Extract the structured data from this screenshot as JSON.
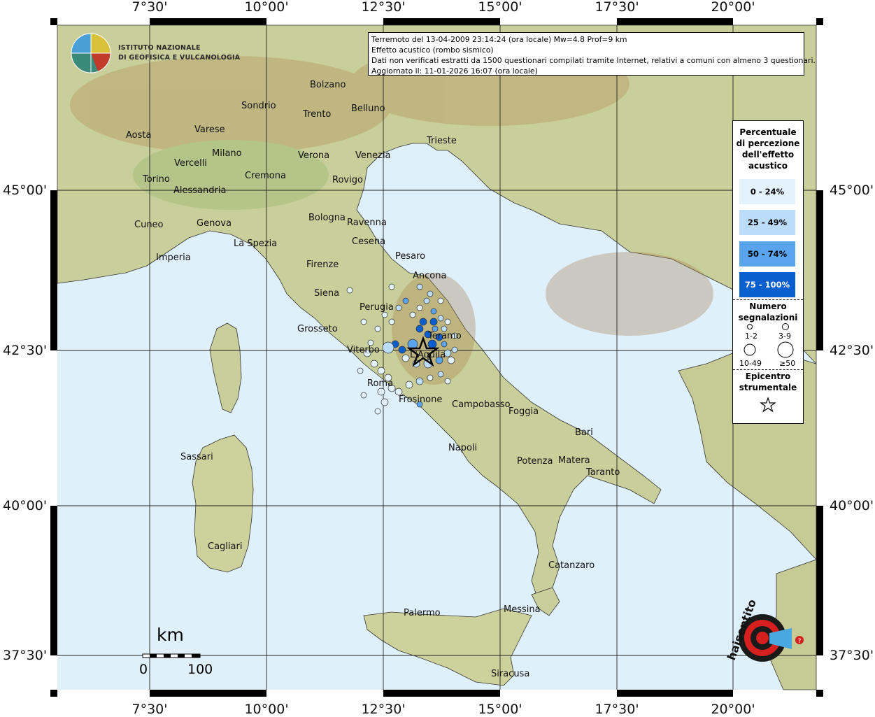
{
  "info_box": {
    "line1": "Terremoto del 13-04-2009 23:14:24 (ora locale) Mw=4.8 Prof=9 km",
    "line2": "Effetto acustico (rombo sismico)",
    "line3": "Dati non verificati estratti da 1500 questionari compilati tramite Internet, relativi a comuni con almeno 3 questionari.",
    "line4": "Aggiornato il: 11-01-2026 16:07 (ora locale)"
  },
  "institute": {
    "line1": "ISTITUTO NAZIONALE",
    "line2": "DI GEOFISICA E VULCANOLOGIA"
  },
  "legend": {
    "title_lines": [
      "Percentuale",
      "di percezione",
      "dell'effetto",
      "acustico"
    ],
    "classes": [
      {
        "label": "0 - 24%",
        "color": "#e3f2fd"
      },
      {
        "label": "25 - 49%",
        "color": "#bcdcfb"
      },
      {
        "label": "50 - 74%",
        "color": "#5aa4ee"
      },
      {
        "label": "75 - 100%",
        "color": "#0a5fcf"
      }
    ],
    "count_title_lines": [
      "Numero",
      "segnalazioni"
    ],
    "count_classes": [
      "1-2",
      "3-9",
      "10-49",
      "≥50"
    ],
    "epicenter_lines": [
      "Epicentro",
      "strumentale"
    ]
  },
  "axes": {
    "lon_labels": [
      "7°30'",
      "10°00'",
      "12°30'",
      "15°00'",
      "17°30'",
      "20°00'"
    ],
    "lat_labels": [
      "45°00'",
      "42°30'",
      "40°00'",
      "37°30'"
    ]
  },
  "scale_bar": {
    "unit": "km",
    "start": "0",
    "end": "100"
  },
  "cities": [
    {
      "name": "Aosta"
    },
    {
      "name": "Varese"
    },
    {
      "name": "Sondrio"
    },
    {
      "name": "Bolzano"
    },
    {
      "name": "Belluno"
    },
    {
      "name": "Trento"
    },
    {
      "name": "Milano"
    },
    {
      "name": "Vercelli"
    },
    {
      "name": "Verona"
    },
    {
      "name": "Venezia"
    },
    {
      "name": "Trieste"
    },
    {
      "name": "Cremona"
    },
    {
      "name": "Rovigo"
    },
    {
      "name": "Torino"
    },
    {
      "name": "Alessandria"
    },
    {
      "name": "Bologna"
    },
    {
      "name": "Ravenna"
    },
    {
      "name": "Cuneo"
    },
    {
      "name": "Genova"
    },
    {
      "name": "Cesena"
    },
    {
      "name": "La Spezia"
    },
    {
      "name": "Pesaro"
    },
    {
      "name": "Imperia"
    },
    {
      "name": "Firenze"
    },
    {
      "name": "Ancona"
    },
    {
      "name": "Siena"
    },
    {
      "name": "Perugia"
    },
    {
      "name": "Grosseto"
    },
    {
      "name": "Teramo"
    },
    {
      "name": "Viterbo"
    },
    {
      "name": "L'Aquila"
    },
    {
      "name": "Roma"
    },
    {
      "name": "Frosinone"
    },
    {
      "name": "Campobasso"
    },
    {
      "name": "Foggia"
    },
    {
      "name": "Bari"
    },
    {
      "name": "Napoli"
    },
    {
      "name": "Potenza"
    },
    {
      "name": "Matera"
    },
    {
      "name": "Taranto"
    },
    {
      "name": "Sassari"
    },
    {
      "name": "Cagliari"
    },
    {
      "name": "Catanzaro"
    },
    {
      "name": "Palermo"
    },
    {
      "name": "Messina"
    },
    {
      "name": "Siracusa"
    }
  ],
  "colors": {
    "sea": "#dff0fb",
    "land": "#c9cf9a",
    "frame": "#000000"
  },
  "watermark": "www.haisentitoilterremoto.it"
}
